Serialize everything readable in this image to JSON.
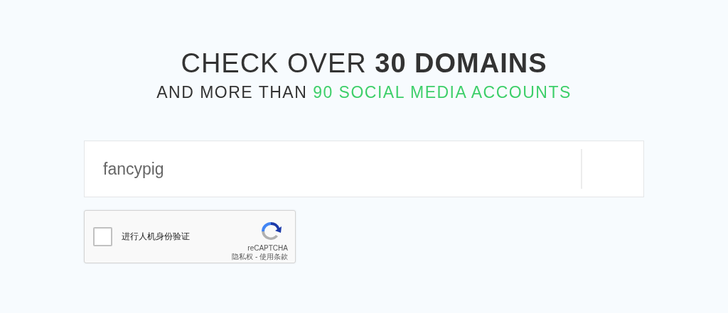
{
  "heading": "CHECK OVER **30 DOMAINS**",
  "subheading": {
    "text": "AND MORE THAN",
    "highlight": "90 SOCIAL MEDIA ACCOUNTS"
  },
  "search": {
    "value": "fancypig"
  },
  "captcha": {
    "label": "进行人机身份验证",
    "checked": false,
    "brand": "reCAPTCHA",
    "footer": "隐私权 - 使用条款"
  }
}
